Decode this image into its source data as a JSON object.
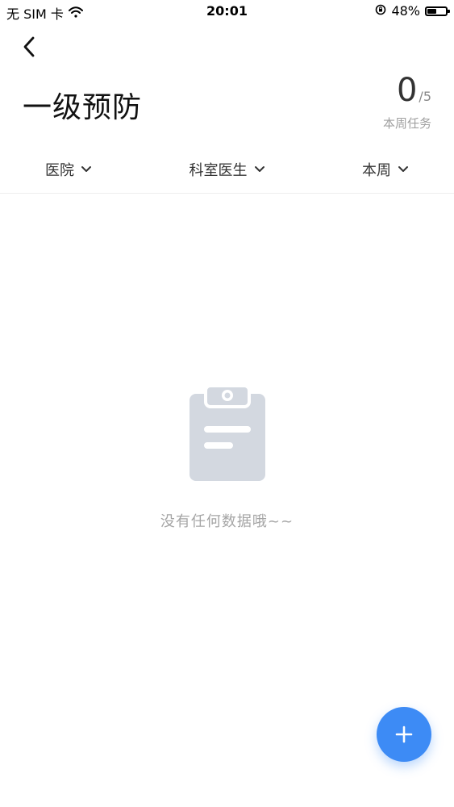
{
  "status_bar": {
    "carrier": "无 SIM 卡",
    "time": "20:01",
    "battery_percent": "48%",
    "battery_level": 0.48
  },
  "header": {
    "title": "一级预防"
  },
  "weekly": {
    "count": "0",
    "total": "/5",
    "label": "本周任务"
  },
  "filters": [
    {
      "label": "医院"
    },
    {
      "label": "科室医生"
    },
    {
      "label": "本周"
    }
  ],
  "empty": {
    "message": "没有任何数据哦~~"
  },
  "colors": {
    "accent": "#3d8bf5",
    "empty_icon": "#d3d8e0"
  }
}
